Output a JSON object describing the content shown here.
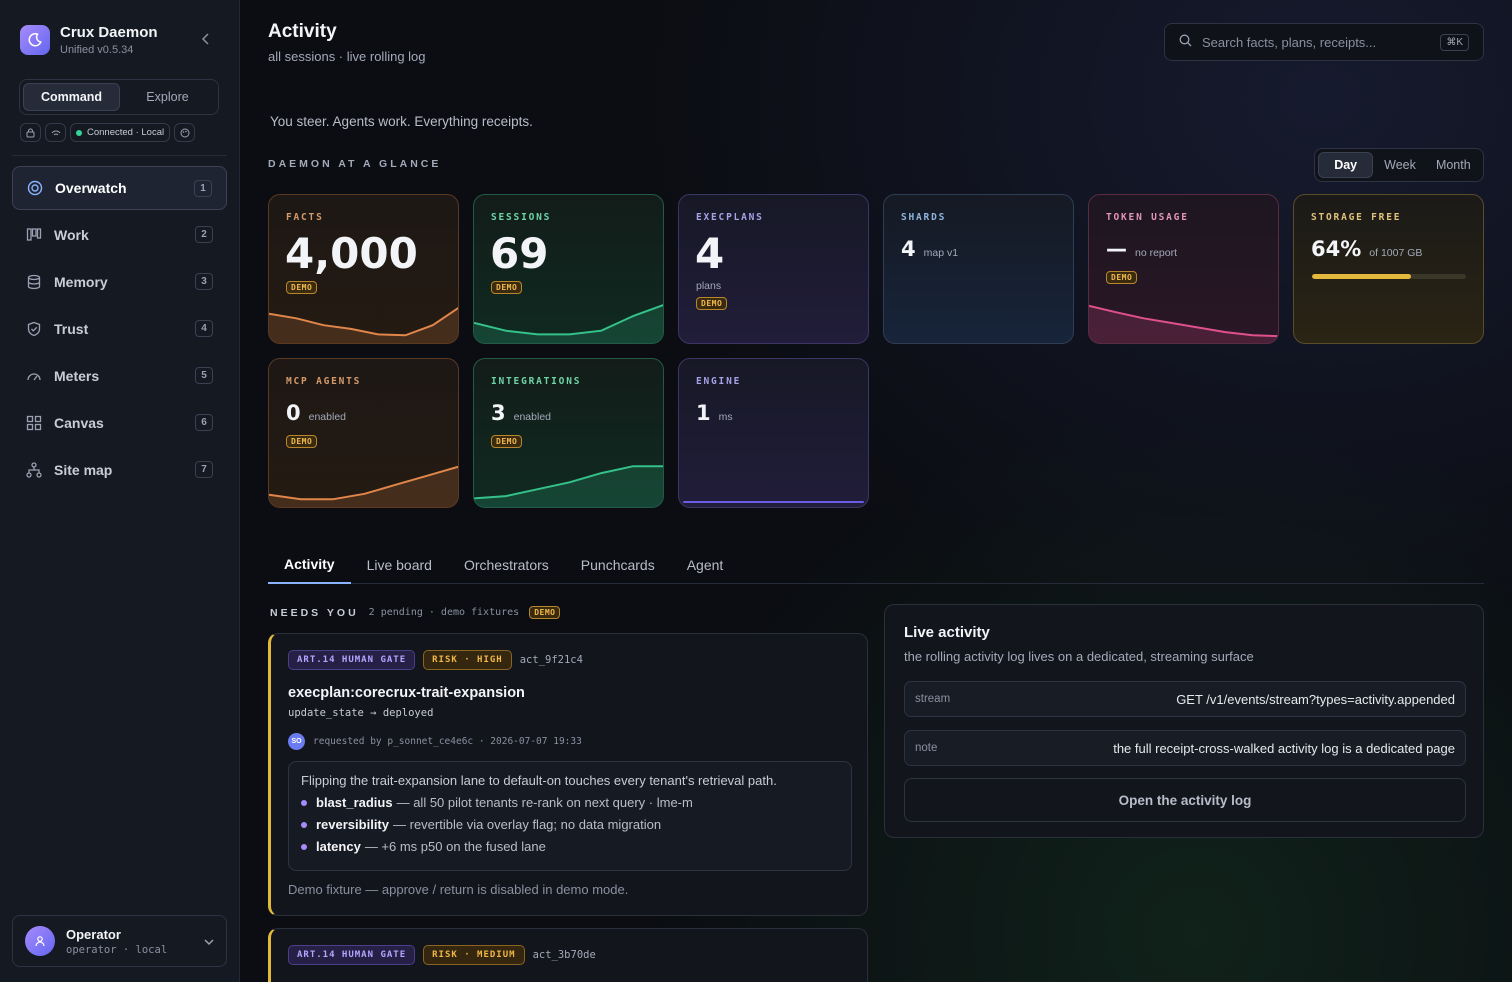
{
  "app": {
    "name": "Crux Daemon",
    "version": "Unified v0.5.34"
  },
  "modes": [
    "Command",
    "Explore"
  ],
  "status": {
    "connection": "Connected · Local"
  },
  "nav": [
    {
      "label": "Overwatch",
      "key": "1"
    },
    {
      "label": "Work",
      "key": "2"
    },
    {
      "label": "Memory",
      "key": "3"
    },
    {
      "label": "Trust",
      "key": "4"
    },
    {
      "label": "Meters",
      "key": "5"
    },
    {
      "label": "Canvas",
      "key": "6"
    },
    {
      "label": "Site map",
      "key": "7"
    }
  ],
  "user": {
    "name": "Operator",
    "sub": "operator · local"
  },
  "header": {
    "title": "Activity",
    "subtitle": "all sessions · live rolling log"
  },
  "search": {
    "placeholder": "Search facts, plans, receipts...",
    "shortcut": "⌘K"
  },
  "tagline": "You steer. Agents work. Everything receipts.",
  "glance": {
    "title": "DAEMON AT A GLANCE",
    "ranges": [
      "Day",
      "Week",
      "Month"
    ],
    "active_range": "Day",
    "cards": {
      "facts": {
        "label": "FACTS",
        "value": "4,000",
        "badge": "DEMO",
        "spark": [
          0.55,
          0.45,
          0.3,
          0.22,
          0.1,
          0.08,
          0.3,
          0.7
        ]
      },
      "sessions": {
        "label": "SESSIONS",
        "value": "69",
        "badge": "DEMO",
        "spark": [
          0.35,
          0.18,
          0.1,
          0.1,
          0.18,
          0.5,
          0.75
        ]
      },
      "execplans": {
        "label": "EXECPLANS",
        "value": "4",
        "unit": "plans",
        "badge": "DEMO"
      },
      "shards": {
        "label": "SHARDS",
        "value": "4",
        "unit": "map v1"
      },
      "tokens": {
        "label": "TOKEN USAGE",
        "value": "—",
        "unit": "no report",
        "badge": "DEMO",
        "spark": [
          0.72,
          0.58,
          0.45,
          0.35,
          0.25,
          0.15,
          0.08,
          0.06
        ]
      },
      "storage": {
        "label": "STORAGE FREE",
        "value": "64%",
        "unit": "of 1007 GB",
        "fill": 0.64
      },
      "mcp": {
        "label": "MCP AGENTS",
        "value": "0",
        "unit": "enabled",
        "badge": "DEMO",
        "spark": [
          0.18,
          0.08,
          0.08,
          0.2,
          0.4,
          0.6,
          0.8
        ]
      },
      "integrations": {
        "label": "INTEGRATIONS",
        "value": "3",
        "unit": "enabled",
        "badge": "DEMO",
        "spark": [
          0.1,
          0.15,
          0.3,
          0.45,
          0.65,
          0.8,
          0.8
        ]
      },
      "engine": {
        "label": "ENGINE",
        "value": "1",
        "unit": "ms"
      }
    }
  },
  "tabs": [
    "Activity",
    "Live board",
    "Orchestrators",
    "Punchcards",
    "Agent"
  ],
  "needs": {
    "title": "NEEDS YOU",
    "sub": "2 pending · demo fixtures",
    "badge": "DEMO"
  },
  "gates": [
    {
      "art": "ART.14 HUMAN GATE",
      "risk": "RISK · HIGH",
      "id": "act_9f21c4",
      "title": "execplan:corecrux-trait-expansion",
      "state": "update_state → deployed",
      "avatar": "SO",
      "requested": "requested by p_sonnet_ce4e6c · 2026-07-07 19:33",
      "lead": "Flipping the trait-expansion lane to default-on touches every tenant's retrieval path.",
      "bullets": [
        {
          "key": "blast_radius",
          "text": "— all 50 pilot tenants re-rank on next query · lme-m"
        },
        {
          "key": "reversibility",
          "text": "— revertible via overlay flag; no data migration"
        },
        {
          "key": "latency",
          "text": "— +6 ms p50 on the fused lane"
        }
      ],
      "foot": "Demo fixture — approve / return is disabled in demo mode."
    },
    {
      "art": "ART.14 HUMAN GATE",
      "risk": "RISK · MEDIUM",
      "id": "act_3b70de"
    }
  ],
  "live": {
    "title": "Live activity",
    "sub": "the rolling activity log lives on a dedicated, streaming surface",
    "stream_key": "stream",
    "stream_val": "GET /v1/events/stream?types=activity.appended",
    "note_key": "note",
    "note_val": "the full receipt-cross-walked activity log is a dedicated page",
    "button": "Open the activity log"
  },
  "colors": {
    "accent": "#8ab4ff",
    "gate": "#e2b93b",
    "demo": "#f0b84a",
    "orange": "#e0864a",
    "green": "#34c28a",
    "pink": "#e0508c",
    "purple": "#6b5ce7"
  }
}
